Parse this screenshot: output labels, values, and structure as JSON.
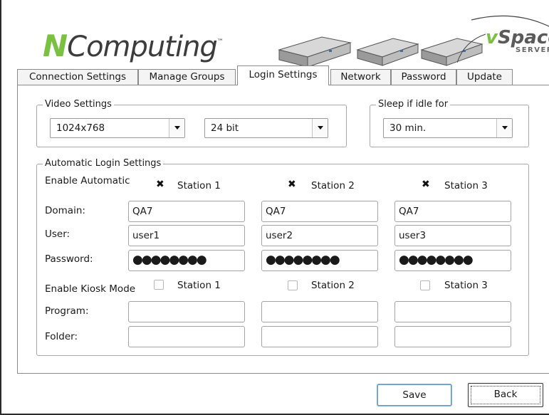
{
  "brand": {
    "logo_n": "N",
    "logo_rest": "Computing",
    "trademark": "™",
    "product_v": "v",
    "product_rest": "Space",
    "product_tm": "™",
    "product_sub": "SERVER"
  },
  "tabs": [
    {
      "label": "Connection Settings"
    },
    {
      "label": "Manage Groups"
    },
    {
      "label": "Login Settings"
    },
    {
      "label": "Network"
    },
    {
      "label": "Password"
    },
    {
      "label": "Update"
    }
  ],
  "active_tab": "Login Settings",
  "video_settings": {
    "title": "Video Settings",
    "resolution": "1024x768",
    "color_depth": "24 bit"
  },
  "sleep": {
    "title": "Sleep if idle for",
    "value": "30 min."
  },
  "auto_login": {
    "title": "Automatic Login Settings",
    "enable_label": "Enable Automatic",
    "domain_label": "Domain:",
    "user_label": "User:",
    "password_label": "Password:",
    "kiosk_label": "Enable Kiosk Mode",
    "program_label": "Program:",
    "folder_label": "Folder:",
    "stations": [
      {
        "name": "Station 1",
        "auto": true,
        "domain": "QA7",
        "user": "user1",
        "password": "●●●●●●●●",
        "kiosk": false,
        "program": "",
        "folder": ""
      },
      {
        "name": "Station 2",
        "auto": true,
        "domain": "QA7",
        "user": "user2",
        "password": "●●●●●●●●",
        "kiosk": false,
        "program": "",
        "folder": ""
      },
      {
        "name": "Station 3",
        "auto": true,
        "domain": "QA7",
        "user": "user3",
        "password": "●●●●●●●●",
        "kiosk": false,
        "program": "",
        "folder": ""
      }
    ]
  },
  "buttons": {
    "save": "Save",
    "back": "Back"
  }
}
